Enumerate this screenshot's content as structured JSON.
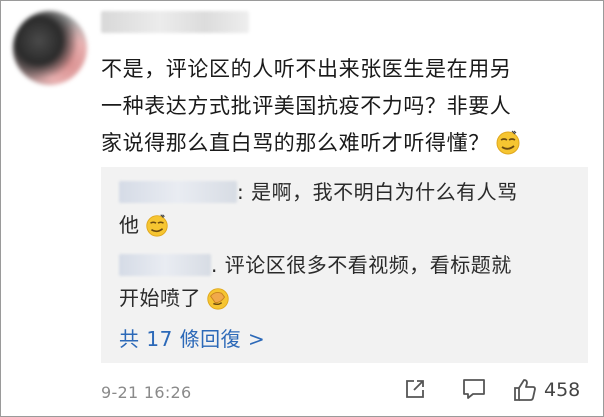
{
  "comment": {
    "text_line1": "不是，评论区的人听不出来张医生是在用另",
    "text_line2": "一种表达方式批评美国抗疫不力吗？非要人",
    "text_line3": "家说得那么直白骂的那么难听才听得懂？",
    "emoji": "smirk-emoji",
    "timestamp": "9-21 16:26",
    "like_count": "458"
  },
  "replies": [
    {
      "text_line1": ": 是啊，我不明白为什么有人骂",
      "text_line2": "他",
      "emoji": "smirk-emoji"
    },
    {
      "text_line1": ". 评论区很多不看视频，看标题就",
      "text_line2": "开始喷了",
      "emoji": "facepalm-emoji"
    }
  ],
  "more_replies_label": "共 17 條回復 >",
  "colors": {
    "link": "#2c69b8",
    "reply_bg": "#f2f2f2",
    "timestamp": "#8a8a8a"
  },
  "icons": [
    "share-icon",
    "comment-icon",
    "like-icon"
  ]
}
